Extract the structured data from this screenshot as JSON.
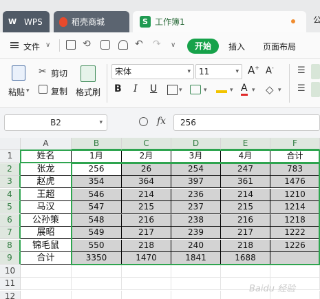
{
  "tabs": {
    "wps": "WPS",
    "daoke": "稻壳商城",
    "workbook": "工作簿1",
    "extra": "公"
  },
  "menu": {
    "file": "文件",
    "start": "开始",
    "insert": "插入",
    "page_layout": "页面布局"
  },
  "ribbon": {
    "paste": "粘贴",
    "cut": "剪切",
    "copy": "复制",
    "format_painter": "格式刷",
    "font_name": "宋体",
    "font_size": "11",
    "bold": "B",
    "italic": "I",
    "underline": "U",
    "font_color": "A",
    "grow_font": "A",
    "shrink_font": "A"
  },
  "formula_bar": {
    "cell_ref": "B2",
    "fx": "fx",
    "value": "256"
  },
  "grid": {
    "columns": [
      "A",
      "B",
      "C",
      "D",
      "E",
      "F"
    ],
    "rows": [
      "1",
      "2",
      "3",
      "4",
      "5",
      "6",
      "7",
      "8",
      "9",
      "10",
      "11",
      "12"
    ],
    "data": [
      [
        "姓名",
        "1月",
        "2月",
        "3月",
        "4月",
        "合计"
      ],
      [
        "张龙",
        "256",
        "26",
        "254",
        "247",
        "783"
      ],
      [
        "赵虎",
        "354",
        "364",
        "397",
        "361",
        "1476"
      ],
      [
        "王超",
        "546",
        "214",
        "236",
        "214",
        "1210"
      ],
      [
        "马汉",
        "547",
        "215",
        "237",
        "215",
        "1214"
      ],
      [
        "公孙策",
        "548",
        "216",
        "238",
        "216",
        "1218"
      ],
      [
        "展昭",
        "549",
        "217",
        "239",
        "217",
        "1222"
      ],
      [
        "锦毛鼠",
        "550",
        "218",
        "240",
        "218",
        "1226"
      ],
      [
        "合计",
        "3350",
        "1470",
        "1841",
        "1688",
        ""
      ]
    ]
  },
  "watermark": "Baidu 经验",
  "colors": {
    "accent_green": "#16a24a",
    "selection_border": "#2ea44f",
    "cell_shade": "#d3d3d3"
  }
}
